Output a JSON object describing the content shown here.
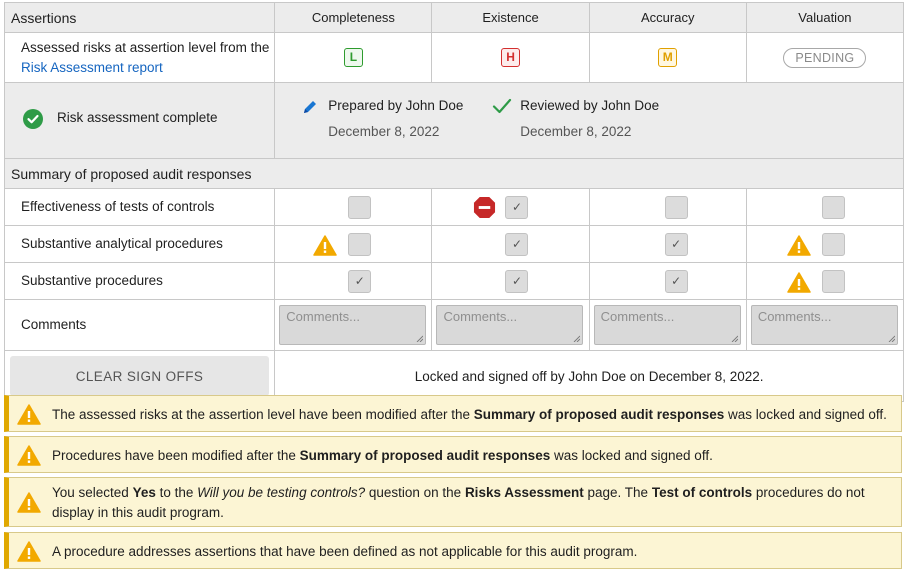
{
  "header": {
    "assertions": "Assertions",
    "columns": [
      "Completeness",
      "Existence",
      "Accuracy",
      "Valuation"
    ]
  },
  "assessed_risks": {
    "label_prefix": "Assessed risks at assertion level from the ",
    "link_text": "Risk Assessment report",
    "levels": [
      "L",
      "H",
      "M",
      "PENDING"
    ]
  },
  "signoff": {
    "status": "Risk assessment complete",
    "prepared_label": "Prepared by John Doe",
    "prepared_date": "December 8, 2022",
    "reviewed_label": "Reviewed by John Doe",
    "reviewed_date": "December 8, 2022"
  },
  "summary": {
    "title": "Summary of proposed audit responses",
    "rows": [
      {
        "label": "Effectiveness of tests of controls",
        "checked": [
          false,
          true,
          false,
          false
        ],
        "warning": [
          false,
          false,
          false,
          false
        ],
        "stop": [
          false,
          true,
          false,
          false
        ]
      },
      {
        "label": "Substantive analytical procedures",
        "checked": [
          false,
          true,
          true,
          false
        ],
        "warning": [
          true,
          false,
          false,
          true
        ],
        "stop": [
          false,
          false,
          false,
          false
        ]
      },
      {
        "label": "Substantive procedures",
        "checked": [
          true,
          true,
          true,
          false
        ],
        "warning": [
          false,
          false,
          false,
          true
        ],
        "stop": [
          false,
          false,
          false,
          false
        ]
      }
    ],
    "comments_label": "Comments",
    "comments_placeholder": "Comments...",
    "clear_button": "CLEAR SIGN OFFS",
    "locked_text": "Locked and signed off by John Doe on December 8, 2022."
  },
  "alerts": {
    "a1": {
      "p1": "The assessed risks at the assertion level have been modified after the ",
      "b1": "Summary of proposed audit responses",
      "p2": " was locked and signed off."
    },
    "a2": {
      "p1": "Procedures have been modified after the ",
      "b1": "Summary of proposed audit responses",
      "p2": " was locked and signed off."
    },
    "a3": {
      "p1": "You selected ",
      "b1": "Yes",
      "p2": " to the ",
      "i1": "Will you be testing controls?",
      "p3": " question on the ",
      "b2": "Risks Assessment",
      "p4": " page. The ",
      "b3": "Test of controls",
      "p5": " procedures do not display in this audit program."
    },
    "a4": {
      "p1": "A procedure addresses assertions that have been defined as not applicable for this audit program."
    }
  },
  "colors": {
    "low": "#2e9b2e",
    "high": "#d32f2f",
    "medium": "#e0a000",
    "warning": "#f2a900",
    "stop": "#c62828",
    "link": "#1565c0",
    "alert_bg": "#fcf5d4"
  },
  "icons": {
    "signoff_status": "check-circle-icon",
    "prepared": "pencil-icon",
    "reviewed": "checkmark-icon",
    "warning": "warning-triangle-icon",
    "stop": "stop-sign-icon"
  }
}
